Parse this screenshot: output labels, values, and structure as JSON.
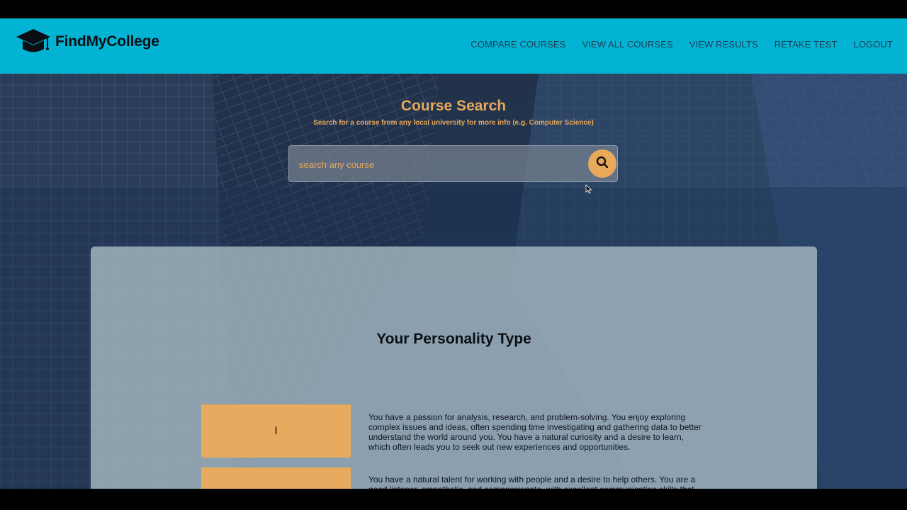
{
  "brand": {
    "name": "FindMyCollege",
    "logo_icon": "graduation-cap-icon"
  },
  "nav": {
    "links": [
      "COMPARE COURSES",
      "VIEW ALL COURSES",
      "VIEW RESULTS",
      "RETAKE TEST",
      "LOGOUT"
    ]
  },
  "search": {
    "title": "Course Search",
    "subtitle": "Search for a course from any local university for more info (e.g. Computer Science)",
    "placeholder": "search any course",
    "button_icon": "search-icon"
  },
  "personality": {
    "title": "Your Personality Type",
    "traits": [
      {
        "letter": "I",
        "description": "You have a passion for analysis, research, and problem-solving. You enjoy exploring complex issues and ideas, often spending time investigating and gathering data to better understand the world around you. You have a natural curiosity and a desire to learn, which often leads you to seek out new experiences and opportunities."
      },
      {
        "letter": "",
        "description": "You have a natural talent for working with people and a desire to help others. You are a good listener, empathetic, and compassionate, with excellent communication skills that"
      }
    ]
  },
  "colors": {
    "navbar": "#02b3d3",
    "accent": "#e7a75a",
    "card": "#a8bac4"
  }
}
